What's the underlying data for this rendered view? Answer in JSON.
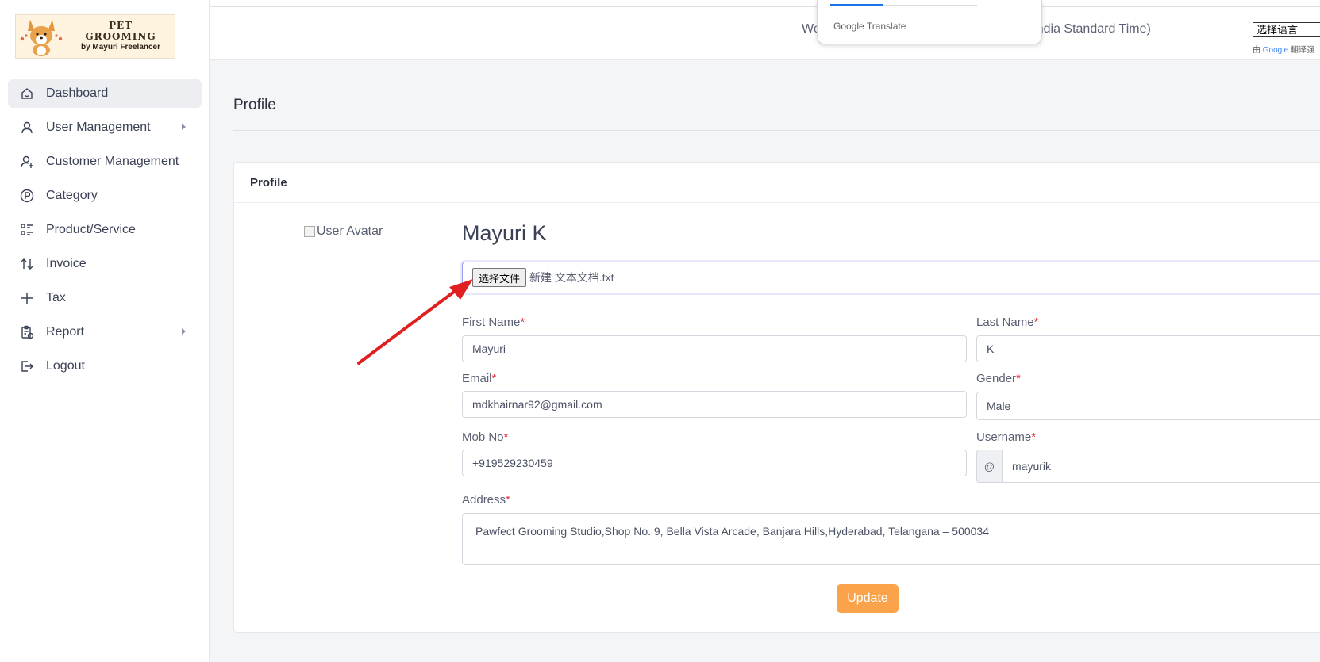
{
  "logo": {
    "line1": "PET",
    "line2": "GROOMING",
    "line3": "by Mayuri Freelancer"
  },
  "sidebar": {
    "items": [
      {
        "label": "Dashboard",
        "icon": "home-icon",
        "active": true
      },
      {
        "label": "User Management",
        "icon": "user-icon",
        "has_submenu": true
      },
      {
        "label": "Customer Management",
        "icon": "user-plus-icon"
      },
      {
        "label": "Category",
        "icon": "parking-circle-icon"
      },
      {
        "label": "Product/Service",
        "icon": "list-details-icon"
      },
      {
        "label": "Invoice",
        "icon": "arrows-sort-icon"
      },
      {
        "label": "Tax",
        "icon": "plus-icon"
      },
      {
        "label": "Report",
        "icon": "report-icon",
        "has_submenu": true
      },
      {
        "label": "Logout",
        "icon": "logout-icon"
      }
    ]
  },
  "header": {
    "welcome_left": "We",
    "welcome_right": "ndia Standard Time)",
    "google_translate_label_google": "Google",
    "google_translate_label_translate": "Translate",
    "language_select_value": "选择语言",
    "powered_by_prefix": "由",
    "powered_by_google": "Google",
    "powered_by_suffix": "翻译强"
  },
  "page": {
    "title": "Profile"
  },
  "card": {
    "header": "Profile",
    "avatar_alt": "User Avatar",
    "user_name": "Mayuri K",
    "file_button": "选择文件",
    "file_name": "新建 文本文档.txt",
    "fields": {
      "first_name": {
        "label": "First Name",
        "value": "Mayuri"
      },
      "last_name": {
        "label": "Last Name",
        "value": "K"
      },
      "email": {
        "label": "Email",
        "value": "mdkhairnar92@gmail.com"
      },
      "gender": {
        "label": "Gender",
        "value": "Male"
      },
      "mob_no": {
        "label": "Mob No",
        "value": "+919529230459"
      },
      "username": {
        "label": "Username",
        "prefix": "@",
        "value": "mayurik"
      },
      "address": {
        "label": "Address",
        "value": "Pawfect Grooming Studio,Shop No. 9, Bella Vista Arcade, Banjara Hills,Hyderabad, Telangana – 500034"
      }
    },
    "required_mark": "*",
    "update_button": "Update"
  },
  "colors": {
    "accent": "#fba34a",
    "required": "#e0303a",
    "annotation_arrow": "#e02020",
    "focus_border": "#9aa2f0"
  }
}
